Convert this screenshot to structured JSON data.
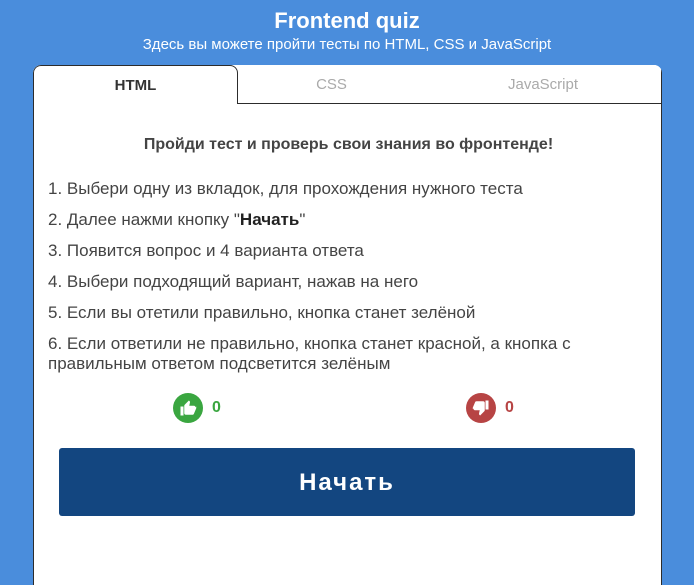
{
  "header": {
    "title": "Frontend quiz",
    "subtitle": "Здесь вы можете пройти тесты по HTML, CSS и JavaScript"
  },
  "tabs": [
    {
      "label": "HTML",
      "active": true
    },
    {
      "label": "CSS",
      "active": false
    },
    {
      "label": "JavaScript",
      "active": false
    }
  ],
  "intro": "Пройди тест и проверь свои знания во фронтенде!",
  "steps": {
    "s1": "1. Выбери одну из вкладок, для прохождения нужного теста",
    "s2_prefix": "2. Далее нажми кнопку \"",
    "s2_bold": "Начать",
    "s2_suffix": "\"",
    "s3": "3. Появится вопрос и 4 варианта ответа",
    "s4": "4. Выбери подходящий вариант, нажав на него",
    "s5": "5. Если вы отетили правильно, кнопка станет зелёной",
    "s6": "6. Если ответили не правильно, кнопка станет красной, а кнопка с правильным ответом подсветится зелёным"
  },
  "score": {
    "likes": "0",
    "dislikes": "0",
    "like_icon": "thumbs-up-icon",
    "dislike_icon": "thumbs-down-icon"
  },
  "start_button": "Начать",
  "colors": {
    "background": "#4a8ddc",
    "button": "#134680",
    "correct": "#3aa640",
    "wrong": "#b74444"
  }
}
